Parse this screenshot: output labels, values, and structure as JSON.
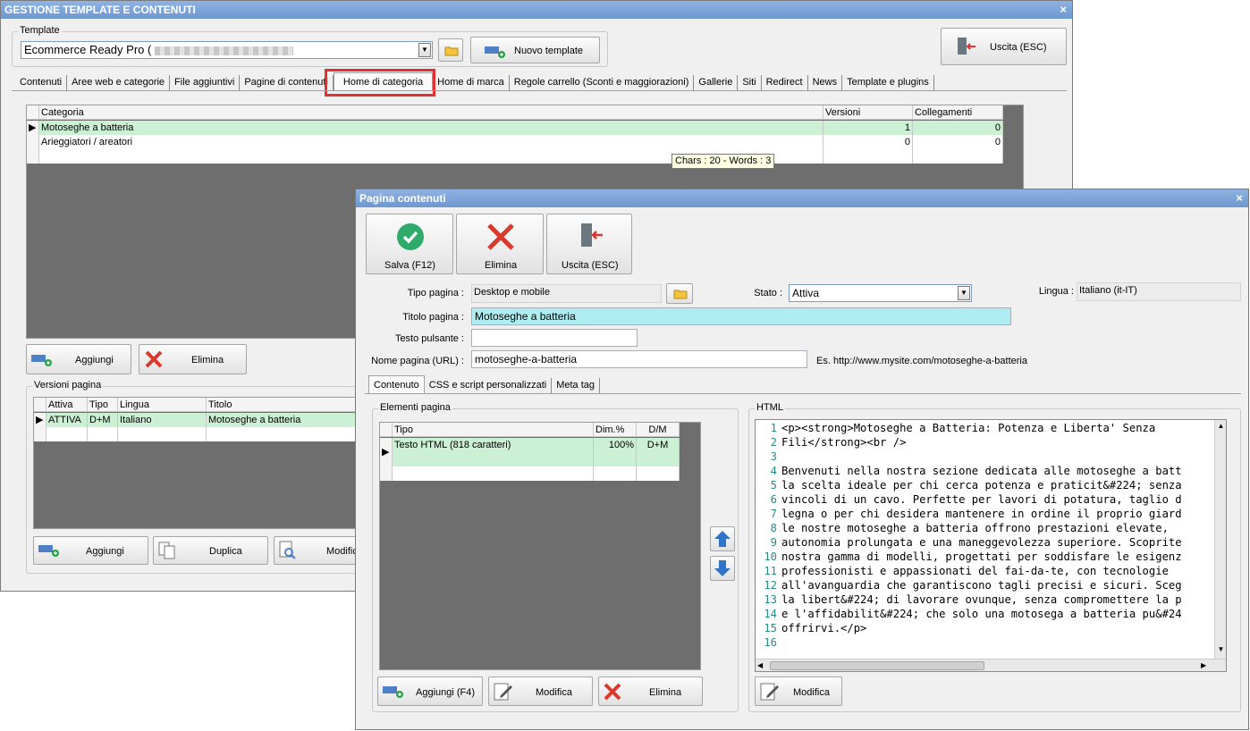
{
  "main_window": {
    "title": "GESTIONE TEMPLATE E CONTENUTI",
    "close": "×",
    "template_group_label": "Template",
    "template_value": "Ecommerce Ready Pro (",
    "new_template_label": "Nuovo template",
    "exit_label": "Uscita (ESC)",
    "tabs": [
      {
        "label": "Contenuti"
      },
      {
        "label": "Aree web e categorie"
      },
      {
        "label": "File aggiuntivi"
      },
      {
        "label": "Pagine di contenuti"
      },
      {
        "label": "Home di categoria"
      },
      {
        "label": "Home di marca"
      },
      {
        "label": "Regole carrello (Sconti e maggiorazioni)"
      },
      {
        "label": "Gallerie"
      },
      {
        "label": "Siti"
      },
      {
        "label": "Redirect"
      },
      {
        "label": "News"
      },
      {
        "label": "Template e plugins"
      }
    ],
    "category_grid": {
      "columns": [
        "Categoria",
        "Versioni",
        "Collegamenti"
      ],
      "rows": [
        {
          "categoria": "Motoseghe a batteria",
          "versioni": "1",
          "collegamenti": "0"
        },
        {
          "categoria": "Arieggiatori / areatori",
          "versioni": "0",
          "collegamenti": "0"
        }
      ]
    },
    "tooltip": "Chars : 20 - Words : 3",
    "add_label": "Aggiungi",
    "delete_label": "Elimina",
    "versions_group_label": "Versioni pagina",
    "versions_grid": {
      "columns": [
        "Attiva",
        "Tipo",
        "Lingua",
        "Titolo"
      ],
      "rows": [
        {
          "attiva": "ATTIVA",
          "tipo": "D+M",
          "lingua": "Italiano",
          "titolo": "Motoseghe a batteria"
        }
      ]
    },
    "versions_add_label": "Aggiungi",
    "duplicate_label": "Duplica",
    "modify_label": "Modifica"
  },
  "dialog": {
    "title": "Pagina contenuti",
    "close": "×",
    "save_label": "Salva (F12)",
    "delete_label": "Elimina",
    "exit_label": "Uscita (ESC)",
    "page_type_label": "Tipo pagina :",
    "page_type_value": "Desktop e mobile",
    "status_label": "Stato :",
    "status_value": "Attiva",
    "language_label": "Lingua :",
    "language_value": "Italiano (it-IT)",
    "page_title_label": "Titolo pagina :",
    "page_title_value": "Motoseghe a batteria",
    "button_text_label": "Testo pulsante :",
    "button_text_value": "",
    "page_name_label": "Nome pagina (URL) :",
    "page_name_value": "motoseghe-a-batteria",
    "url_example": "Es. http://www.mysite.com/motoseghe-a-batteria",
    "tabs": [
      {
        "label": "Contenuto"
      },
      {
        "label": "CSS e script personalizzati"
      },
      {
        "label": "Meta tag"
      }
    ],
    "elements_group_label": "Elementi pagina",
    "elements_grid": {
      "columns": [
        "Tipo",
        "Dim.%",
        "D/M"
      ],
      "rows": [
        {
          "tipo": "Testo HTML (818 caratteri)",
          "dim": "100%",
          "dm": "D+M"
        }
      ]
    },
    "add_f4_label": "Aggiungi (F4)",
    "modify_label": "Modifica",
    "delete2_label": "Elimina",
    "html_group_label": "HTML",
    "html_modify_label": "Modifica",
    "code_lines": [
      {
        "n": "1",
        "t": "<p><strong>Motoseghe a Batteria: Potenza e Liberta' Senza"
      },
      {
        "n": "2",
        "t": "Fili</strong><br />"
      },
      {
        "n": "3",
        "t": ""
      },
      {
        "n": "4",
        "t": "Benvenuti nella nostra sezione dedicata alle motoseghe a batt"
      },
      {
        "n": "5",
        "t": "la scelta ideale per chi cerca potenza e praticit&#224; senza"
      },
      {
        "n": "6",
        "t": "vincoli di un cavo. Perfette per lavori di potatura, taglio d"
      },
      {
        "n": "7",
        "t": "legna o per chi desidera mantenere in ordine il proprio giard"
      },
      {
        "n": "8",
        "t": "le nostre motoseghe a batteria offrono prestazioni elevate,"
      },
      {
        "n": "9",
        "t": "autonomia prolungata e una maneggevolezza superiore. Scoprite"
      },
      {
        "n": "10",
        "t": "nostra gamma di modelli, progettati per soddisfare le esigenz"
      },
      {
        "n": "11",
        "t": "professionisti e appassionati del fai-da-te, con tecnologie"
      },
      {
        "n": "12",
        "t": "all'avanguardia che garantiscono tagli precisi e sicuri. Sceg"
      },
      {
        "n": "13",
        "t": "la libert&#224; di lavorare ovunque, senza compromettere la p"
      },
      {
        "n": "14",
        "t": "e l'affidabilit&#224; che solo una motosega a batteria pu&#24"
      },
      {
        "n": "15",
        "t": "offrirvi.</p>"
      },
      {
        "n": "16",
        "t": ""
      }
    ]
  },
  "colors": {
    "titlebar": "#7fa6dc",
    "selected_row": "#ccf0d4",
    "highlight_field": "#aeeef2",
    "grid_background": "#6e6e6e",
    "tab_highlight": "#e03030",
    "save_green": "#2eaa6a",
    "delete_red": "#d93a2b"
  }
}
